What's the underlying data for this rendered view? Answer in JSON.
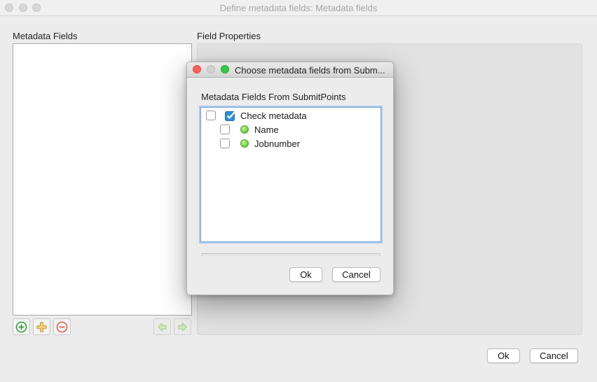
{
  "window": {
    "title": "Define metadata fields: Metadata fields"
  },
  "left_panel": {
    "label": "Metadata Fields",
    "items": []
  },
  "right_panel": {
    "label": "Field Properties"
  },
  "toolbar": {
    "add_icon": "add-circle-icon",
    "add_child_icon": "add-plus-icon",
    "remove_icon": "remove-circle-icon",
    "move_left_icon": "arrow-left-icon",
    "move_right_icon": "arrow-right-icon"
  },
  "footer": {
    "ok_label": "Ok",
    "cancel_label": "Cancel"
  },
  "dialog": {
    "title": "Choose metadata fields from Subm...",
    "section_label": "Metadata Fields From SubmitPoints",
    "tree": [
      {
        "label": "Check metadata",
        "icon": "checkbox-category-icon",
        "checked": false
      },
      {
        "label": "Name",
        "icon": "green-dot-icon",
        "checked": false
      },
      {
        "label": "Jobnumber",
        "icon": "green-dot-icon",
        "checked": false
      }
    ],
    "ok_label": "Ok",
    "cancel_label": "Cancel"
  },
  "colors": {
    "close": "#fc605b",
    "zoom": "#34c84a",
    "focus_ring": "#a9c9ee",
    "field_green": "#6fcf3c"
  }
}
